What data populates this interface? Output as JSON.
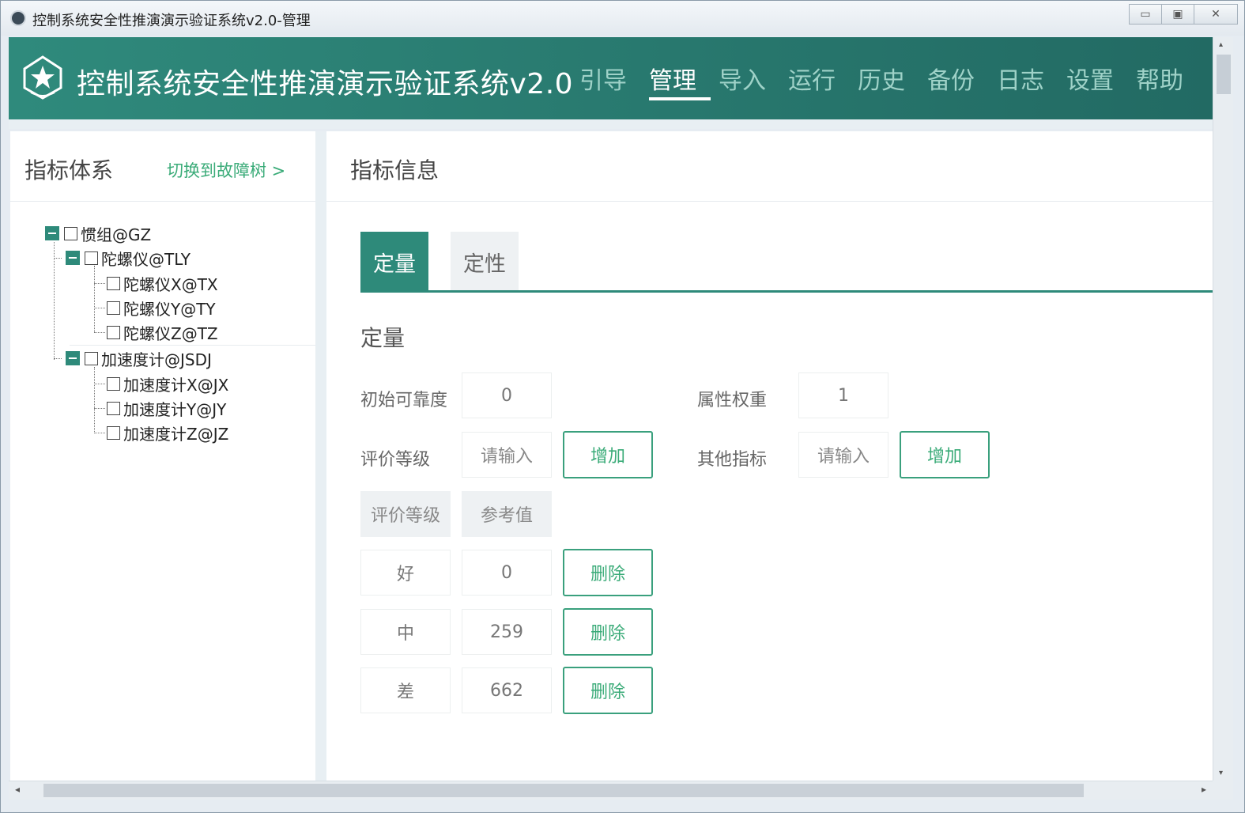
{
  "window": {
    "title": "控制系统安全性推演演示验证系统v2.0-管理",
    "buttons": {
      "minimize": "▭",
      "maximize": "▣",
      "close": "✕"
    }
  },
  "app": {
    "title": "控制系统安全性推演演示验证系统v2.0",
    "nav": [
      {
        "label": "引导",
        "active": false
      },
      {
        "label": "管理",
        "active": true
      },
      {
        "label": "导入",
        "active": false
      },
      {
        "label": "运行",
        "active": false
      },
      {
        "label": "历史",
        "active": false
      },
      {
        "label": "备份",
        "active": false
      },
      {
        "label": "日志",
        "active": false
      },
      {
        "label": "设置",
        "active": false
      },
      {
        "label": "帮助",
        "active": false
      }
    ]
  },
  "left": {
    "title": "指标体系",
    "switch_link": "切换到故障树 >",
    "tree": [
      "惯组@GZ",
      "陀螺仪@TLY",
      "陀螺仪X@TX",
      "陀螺仪Y@TY",
      "陀螺仪Z@TZ",
      "加速度计@JSDJ",
      "加速度计X@JX",
      "加速度计Y@JY",
      "加速度计Z@JZ"
    ]
  },
  "right": {
    "title": "指标信息",
    "tabs": [
      "定量",
      "定性"
    ],
    "section_title": "定量",
    "initial_reliability": {
      "label": "初始可靠度",
      "value": "0"
    },
    "attr_weight": {
      "label": "属性权重",
      "value": "1"
    },
    "eval_level": {
      "label": "评价等级",
      "placeholder": "请输入",
      "add_label": "增加"
    },
    "other_index": {
      "label": "其他指标",
      "placeholder": "请输入",
      "add_label": "增加"
    },
    "table_headers": [
      "评价等级",
      "参考值"
    ],
    "rows": [
      {
        "level": "好",
        "value": "0",
        "delete": "删除"
      },
      {
        "level": "中",
        "value": "259",
        "delete": "删除"
      },
      {
        "level": "差",
        "value": "662",
        "delete": "删除"
      }
    ]
  },
  "scroll": {
    "left": "◂",
    "right": "▸",
    "up": "▴",
    "down": "▾"
  },
  "colors": {
    "primary": "#2e8a7a",
    "accent_text": "#3aab78"
  }
}
